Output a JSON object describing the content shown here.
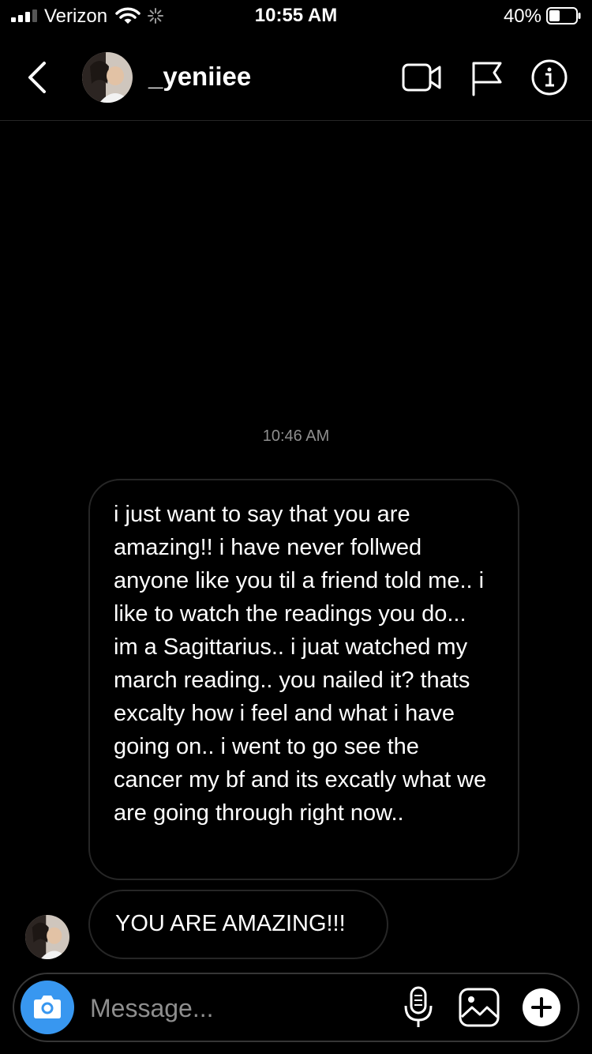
{
  "status_bar": {
    "carrier": "Verizon",
    "time": "10:55 AM",
    "battery": "40%"
  },
  "header": {
    "username": "_yeniiee"
  },
  "conversation": {
    "timestamp": "10:46 AM",
    "messages": [
      {
        "text": "i just want to say that you are amazing!! i have never follwed anyone like you til a friend told me.. i like to watch the readings you do... im a Sagittarius.. i juat watched my march reading.. you nailed it? thats excalty how i feel and what i have going on.. i went to go see the cancer my bf and its excatly what we are going through right now.."
      },
      {
        "text": "YOU ARE AMAZING!!!"
      }
    ]
  },
  "composer": {
    "placeholder": "Message..."
  },
  "colors": {
    "accent": "#3897f0",
    "background": "#000000",
    "muted": "#8e8e8e",
    "border": "#262626"
  },
  "icons": [
    "signal-icon",
    "wifi-icon",
    "loading-icon",
    "battery-icon",
    "back-icon",
    "video-call-icon",
    "flag-icon",
    "info-icon",
    "camera-icon",
    "microphone-icon",
    "gallery-icon",
    "plus-icon"
  ]
}
